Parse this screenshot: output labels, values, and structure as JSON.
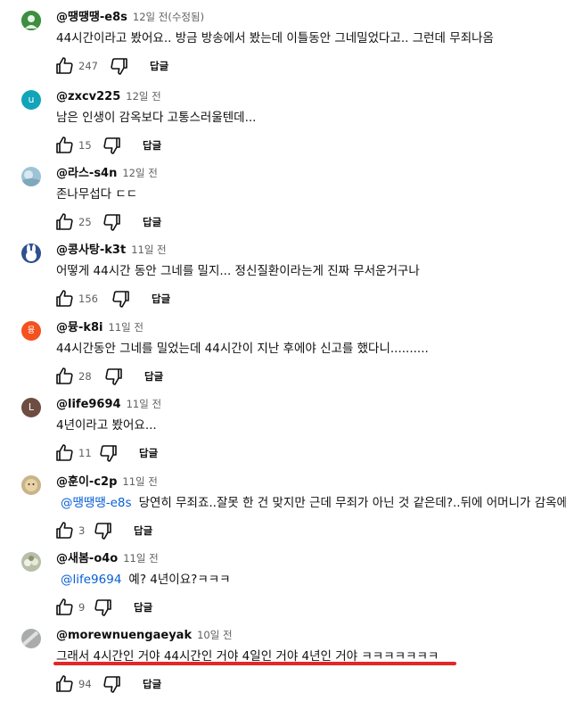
{
  "reply_label": "답글",
  "comments": [
    {
      "author": "@땡땡땡-e8s",
      "time": "12일 전(수정됨)",
      "text": "44시간이라고 봤어요.. 방금 방송에서 봤는데 이틀동안 그네밀었다고.. 그런데 무죄나옴",
      "likes": "247"
    },
    {
      "author": "@zxcv225",
      "time": "12일 전",
      "text": "남은 인생이 감옥보다 고통스러울텐데...",
      "likes": "15",
      "avatar_letter": "u",
      "avatar_color": "#12a4b8"
    },
    {
      "author": "@라스-s4n",
      "time": "12일 전",
      "text": "존나무섭다 ㄷㄷ",
      "likes": "25"
    },
    {
      "author": "@콩사탕-k3t",
      "time": "11일 전",
      "text": "어떻게 44시간 동안 그네를 밀지... 정신질환이라는게 진짜 무서운거구나",
      "likes": "156"
    },
    {
      "author": "@뮹-k8i",
      "time": "11일 전",
      "text": "44시간동안 그네를 밀었는데 44시간이 지난 후에야 신고를 했다니..........",
      "likes": "28",
      "avatar_letter": "뮹",
      "avatar_color": "#f4511e"
    },
    {
      "author": "@life9694",
      "time": "11일 전",
      "text": "4년이라고 봤어요...",
      "likes": "11",
      "avatar_letter": "L",
      "avatar_color": "#6d4c41"
    },
    {
      "author": "@훈이-c2p",
      "time": "11일 전",
      "mention": "@땡땡땡-e8s",
      "text": "당연히 무죄죠..잘못 한 건 맞지만 근데 무죄가 아닌 것 같은데?..뒤에 어머니가 감옥에",
      "likes": "3"
    },
    {
      "author": "@새봄-o4o",
      "time": "11일 전",
      "mention": "@life9694",
      "text": "예? 4년이요?ㅋㅋㅋ",
      "likes": "9"
    },
    {
      "author": "@morewnuengaeyak",
      "time": "10일 전",
      "text": "그래서 4시간인 거야 44시간인 거야 4일인 거야 4년인 거야 ㅋㅋㅋㅋㅋㅋㅋ",
      "likes": "94"
    }
  ]
}
